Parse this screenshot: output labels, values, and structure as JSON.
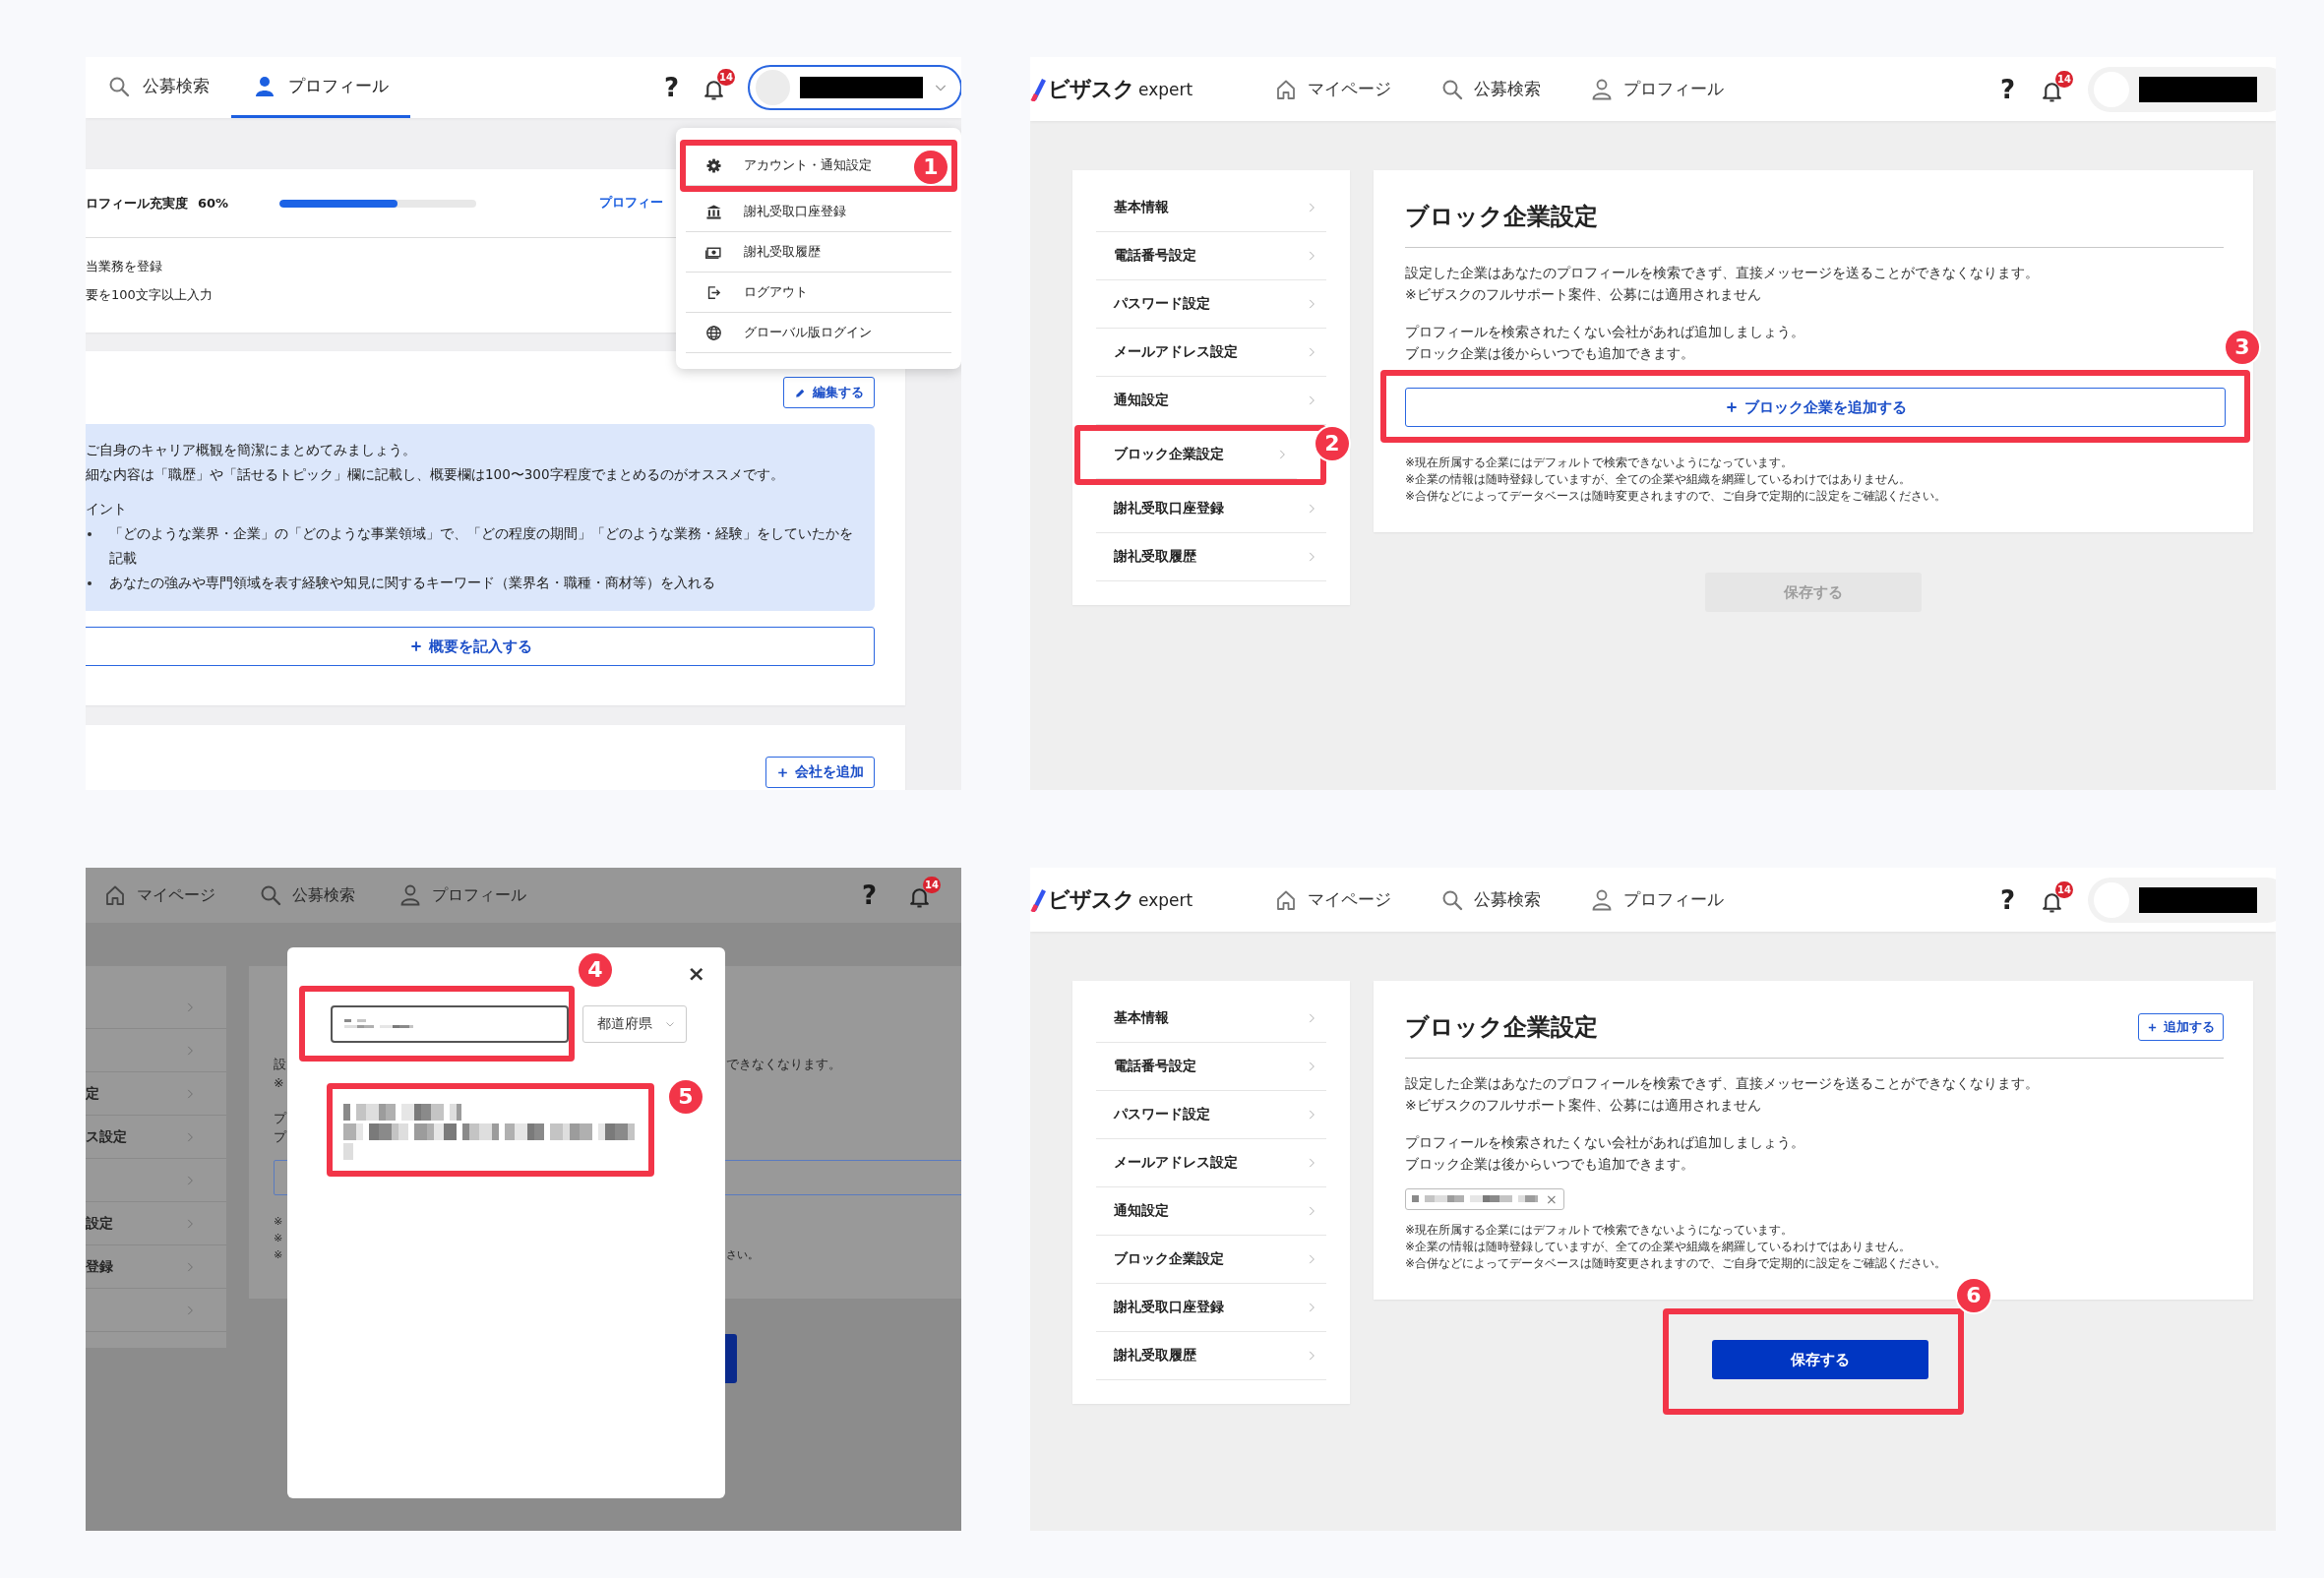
{
  "panels": [
    {
      "kind": "profile_menu",
      "tabs": [
        {
          "label": "公募検索",
          "selected": false
        },
        {
          "label": "プロフィール",
          "selected": true
        }
      ],
      "help": "?",
      "notifications": "14",
      "account": {
        "expanded": true
      },
      "account_menu": [
        {
          "label": "アカウント・通知設定",
          "annotation": "1"
        },
        {
          "label": "謝礼受取口座登録"
        },
        {
          "label": "謝礼受取履歴"
        },
        {
          "label": "ログアウト"
        },
        {
          "label": "グローバル版ログイン"
        }
      ],
      "completeness": {
        "label": "ロフィール充実度",
        "value": "60%",
        "level": 0.6,
        "link": "プロフィー"
      },
      "tasks": [
        "当業務を登録",
        "要を100文字以上入力"
      ],
      "summary": {
        "edit_button": "編集する",
        "tips": [
          "ご自身のキャリア概観を簡潔にまとめてみましょう。",
          "細な内容は「職歴」や「話せるトピック」欄に記載し、概要欄は100〜300字程度でまとめるのがオススメです。"
        ],
        "points_title": "イント",
        "points": [
          "「どのような業界・企業」の「どのような事業領域」で、「どの程度の期間」「どのような業務・経験」をしていたかを記載",
          "あなたの強みや専門領域を表す経験や知見に関するキーワード（業界名・職種・商材等）を入れる"
        ],
        "add_button": "概要を記入する"
      },
      "career": {
        "add_button": "会社を追加"
      }
    },
    {
      "kind": "block_settings",
      "logo": {
        "brand": "ビザスク",
        "suffix": "expert"
      },
      "nav": [
        {
          "label": "マイページ"
        },
        {
          "label": "公募検索"
        },
        {
          "label": "プロフィール"
        }
      ],
      "help": "?",
      "notifications": "14",
      "sidebar": [
        {
          "label": "基本情報"
        },
        {
          "label": "電話番号設定"
        },
        {
          "label": "パスワード設定"
        },
        {
          "label": "メールアドレス設定"
        },
        {
          "label": "通知設定"
        },
        {
          "label": "ブロック企業設定",
          "annotation": "2"
        },
        {
          "label": "謝礼受取口座登録"
        },
        {
          "label": "謝礼受取履歴"
        }
      ],
      "title": "ブロック企業設定",
      "description": [
        "設定した企業はあなたのプロフィールを検索できず、直接メッセージを送ることができなくなります。",
        "※ビザスクのフルサポート案件、公募には適用されません"
      ],
      "hint": [
        "プロフィールを検索されたくない会社があれば追加しましょう。",
        "ブロック企業は後からいつでも追加できます。"
      ],
      "add_button": {
        "label": "ブロック企業を追加する",
        "annotation": "3"
      },
      "notes": [
        "※現在所属する企業にはデフォルトで検索できないようになっています。",
        "※企業の情報は随時登録していますが、全ての企業や組織を網羅しているわけではありません。",
        "※合併などによってデータベースは随時変更されますので、ご自身で定期的に設定をご確認ください。"
      ],
      "save_button": {
        "label": "保存する",
        "disabled": true
      }
    },
    {
      "kind": "company_search_modal",
      "nav": [
        {
          "label": "マイページ"
        },
        {
          "label": "公募検索"
        },
        {
          "label": "プロフィール"
        }
      ],
      "help": "?",
      "notifications": "14",
      "sidebar": [
        {
          "kind": "blank"
        },
        {
          "kind": "blank"
        },
        {
          "kind": "text",
          "text": "定"
        },
        {
          "kind": "text",
          "text": "ス設定"
        },
        {
          "kind": "blank"
        },
        {
          "kind": "text",
          "text": "設定"
        },
        {
          "kind": "text",
          "text": "登録"
        },
        {
          "kind": "blank"
        }
      ],
      "background_fragments": {
        "description": {
          "left": [
            "設",
            "※"
          ],
          "right": "できなくなります。"
        },
        "hint": {
          "left": [
            "プ",
            "プ"
          ]
        },
        "notes": {
          "left": [
            "※",
            "※",
            "※"
          ],
          "right": "さい。"
        }
      },
      "modal": {
        "close": "×",
        "search": {
          "annotation": "4"
        },
        "prefecture": "都道府県",
        "results": [
          {
            "annotation": "5"
          }
        ]
      }
    },
    {
      "kind": "block_settings",
      "logo": {
        "brand": "ビザスク",
        "suffix": "expert"
      },
      "nav": [
        {
          "label": "マイページ"
        },
        {
          "label": "公募検索"
        },
        {
          "label": "プロフィール"
        }
      ],
      "help": "?",
      "notifications": "14",
      "sidebar": [
        {
          "label": "基本情報"
        },
        {
          "label": "電話番号設定"
        },
        {
          "label": "パスワード設定"
        },
        {
          "label": "メールアドレス設定"
        },
        {
          "label": "通知設定"
        },
        {
          "label": "ブロック企業設定"
        },
        {
          "label": "謝礼受取口座登録"
        },
        {
          "label": "謝礼受取履歴"
        }
      ],
      "title": "ブロック企業設定",
      "header_add_button": "追加する",
      "description": [
        "設定した企業はあなたのプロフィールを検索できず、直接メッセージを送ることができなくなります。",
        "※ビザスクのフルサポート案件、公募には適用されません"
      ],
      "hint": [
        "プロフィールを検索されたくない会社があれば追加しましょう。",
        "ブロック企業は後からいつでも追加できます。"
      ],
      "blocked_companies": [
        {
          "remove": "×"
        }
      ],
      "notes": [
        "※現在所属する企業にはデフォルトで検索できないようになっています。",
        "※企業の情報は随時登録していますが、全ての企業や組織を網羅しているわけではありません。",
        "※合併などによってデータベースは随時変更されますので、ご自身で定期的に設定をご確認ください。"
      ],
      "save_button": {
        "label": "保存する",
        "disabled": false,
        "annotation": "6"
      }
    }
  ]
}
